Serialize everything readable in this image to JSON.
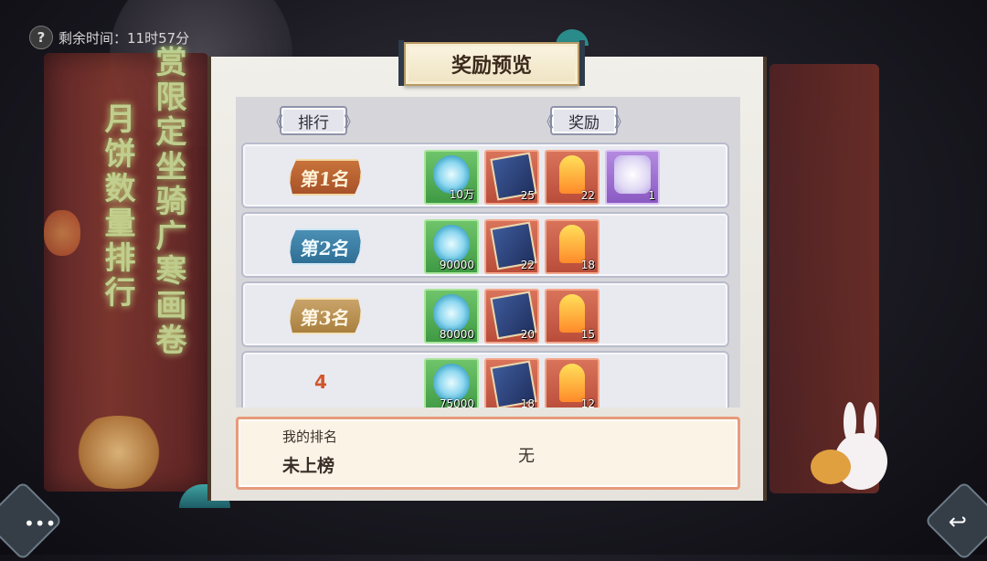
{
  "hud": {
    "help_icon": "?",
    "timer_text": "剩余时间：11时57分"
  },
  "background": {
    "scroll_text_1": "月饼数量排行",
    "scroll_text_2": "赏限定坐骑广寒画卷"
  },
  "panel": {
    "title": "奖励预览",
    "col_rank": "排行",
    "col_reward": "奖励"
  },
  "rows": [
    {
      "rank_label": "第1名",
      "items": [
        {
          "icon": "jade-pendant-icon",
          "count": "10万"
        },
        {
          "icon": "book-icon",
          "count": "25"
        },
        {
          "icon": "talisman-scroll-icon",
          "count": "22"
        },
        {
          "icon": "rabbit-mount-icon",
          "count": "1"
        }
      ]
    },
    {
      "rank_label": "第2名",
      "items": [
        {
          "icon": "jade-pendant-icon",
          "count": "90000"
        },
        {
          "icon": "book-icon",
          "count": "22"
        },
        {
          "icon": "talisman-scroll-icon",
          "count": "18"
        }
      ]
    },
    {
      "rank_label": "第3名",
      "items": [
        {
          "icon": "jade-pendant-icon",
          "count": "80000"
        },
        {
          "icon": "book-icon",
          "count": "20"
        },
        {
          "icon": "talisman-scroll-icon",
          "count": "15"
        }
      ]
    },
    {
      "rank_label": "4",
      "items": [
        {
          "icon": "jade-pendant-icon",
          "count": "75000"
        },
        {
          "icon": "book-icon",
          "count": "18"
        },
        {
          "icon": "talisman-scroll-icon",
          "count": "12"
        }
      ]
    }
  ],
  "my_rank": {
    "label": "我的排名",
    "value": "未上榜",
    "reward": "无"
  },
  "buttons": {
    "chat_icon": "•••",
    "back_icon": "↩"
  }
}
